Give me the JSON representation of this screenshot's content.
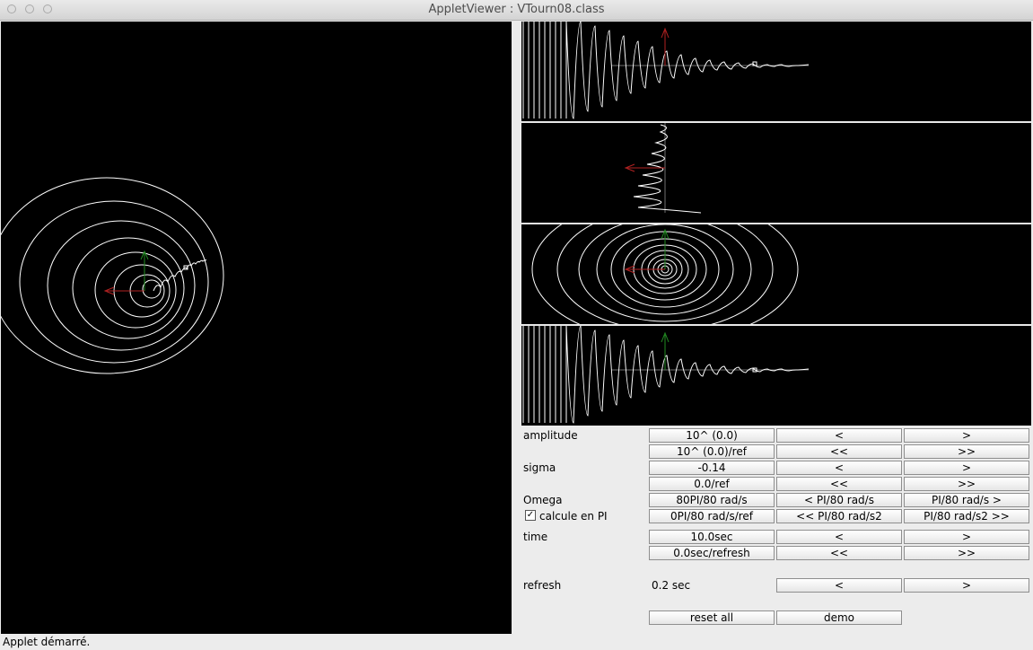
{
  "window": {
    "title": "AppletViewer : VTourn08.class"
  },
  "controls": {
    "amplitude": {
      "label": "amplitude",
      "value": "10^ (0.0)",
      "dec": "<",
      "inc": ">",
      "ref_value": "10^ (0.0)/ref",
      "ref_dec": "<<",
      "ref_inc": ">>"
    },
    "sigma": {
      "label": "sigma",
      "value": "-0.14",
      "dec": "<",
      "inc": ">",
      "ref_value": "0.0/ref",
      "ref_dec": "<<",
      "ref_inc": ">>"
    },
    "omega": {
      "label": "Omega",
      "value": "80PI/80 rad/s",
      "dec": "< PI/80 rad/s",
      "inc": "PI/80 rad/s >",
      "checkbox_label": "calcule en PI",
      "checkbox_checked": true,
      "ref_value": "0PI/80 rad/s/ref",
      "ref_dec": "<< PI/80 rad/s2",
      "ref_inc": "PI/80 rad/s2 >>"
    },
    "time": {
      "label": "time",
      "value": "10.0sec",
      "dec": "<",
      "inc": ">",
      "ref_value": "0.0sec/refresh",
      "ref_dec": "<<",
      "ref_inc": ">>"
    },
    "refresh": {
      "label": "refresh",
      "value": "0.2 sec",
      "dec": "<",
      "inc": ">"
    },
    "reset_all": "reset all",
    "demo": "demo"
  },
  "status": {
    "text": "Applet démarré."
  },
  "colors": {
    "canvas": "#000000",
    "curve": "#ffffff",
    "arrow_red": "#b22222",
    "arrow_green": "#228b22",
    "axis": "#707070"
  }
}
